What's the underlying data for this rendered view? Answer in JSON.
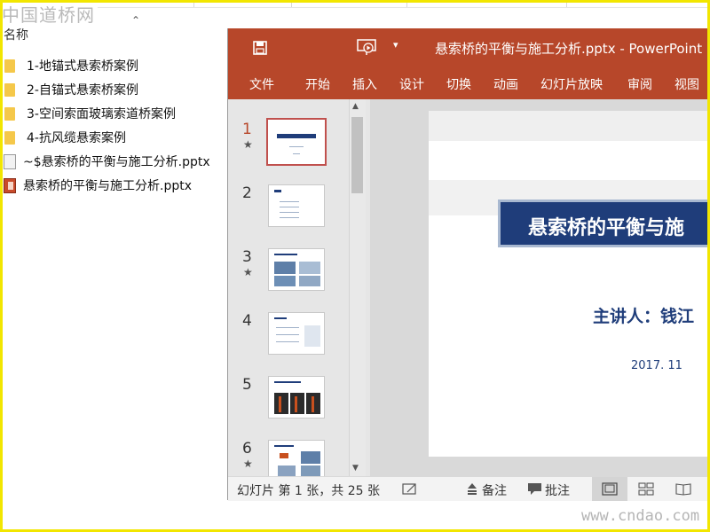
{
  "watermark_top": "中国道桥网",
  "watermark_bottom": "www.cndao.com",
  "explorer": {
    "column_name": "名称",
    "files": [
      {
        "name": "1-地锚式悬索桥案例",
        "type": "folder"
      },
      {
        "name": "2-自锚式悬索桥案例",
        "type": "folder"
      },
      {
        "name": "3-空间索面玻璃索道桥案例",
        "type": "folder"
      },
      {
        "name": "4-抗风缆悬索案例",
        "type": "folder"
      },
      {
        "name": "~$悬索桥的平衡与施工分析.pptx",
        "type": "temp-file"
      },
      {
        "name": "悬索桥的平衡与施工分析.pptx",
        "type": "pptx-file"
      }
    ]
  },
  "ppt": {
    "window_title": "悬索桥的平衡与施工分析.pptx  -  PowerPoint",
    "tabs": [
      "文件",
      "开始",
      "插入",
      "设计",
      "切换",
      "动画",
      "幻灯片放映",
      "审阅",
      "视图"
    ],
    "thumbnails": [
      {
        "num": "1",
        "star": "★"
      },
      {
        "num": "2",
        "star": ""
      },
      {
        "num": "3",
        "star": "★"
      },
      {
        "num": "4",
        "star": ""
      },
      {
        "num": "5",
        "star": ""
      },
      {
        "num": "6",
        "star": "★"
      }
    ],
    "slide": {
      "title": "悬索桥的平衡与施",
      "presenter": "主讲人：钱江",
      "date": "2017. 11"
    },
    "status": {
      "slide_info": "幻灯片 第 1 张，共 25 张",
      "notes_label": "备注",
      "comments_label": "批注"
    }
  },
  "colors": {
    "ribbon": "#b7472a",
    "slide_title_bg": "#1f3d7a",
    "frame": "#f2e600"
  }
}
